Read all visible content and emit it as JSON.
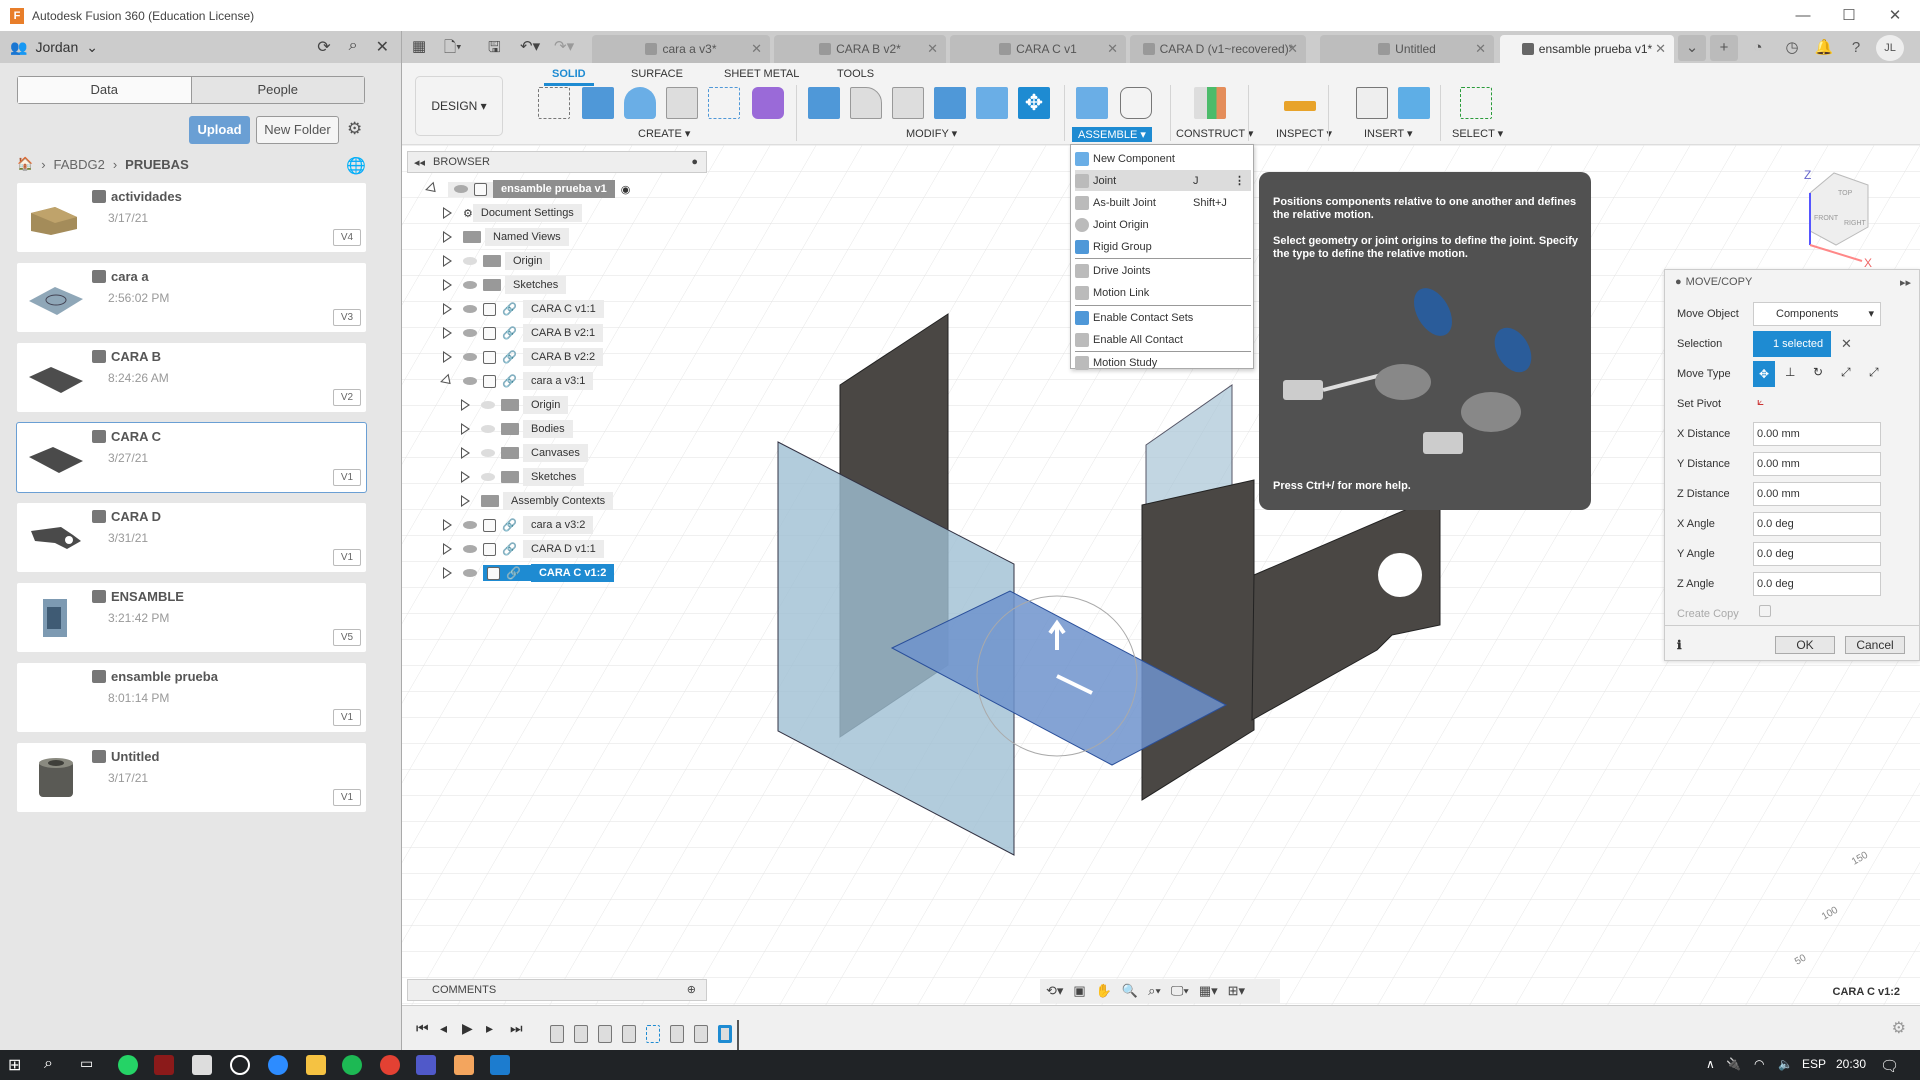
{
  "app": {
    "title": "Autodesk Fusion 360 (Education License)"
  },
  "window_controls": {
    "minimize": "—",
    "maximize": "☐",
    "close": "✕"
  },
  "left_header": {
    "user": "Jordan",
    "icons": [
      "refresh-icon",
      "search-icon",
      "close-icon"
    ]
  },
  "doc_tabs": [
    {
      "label": "cara a v3*",
      "active": false
    },
    {
      "label": "CARA B v2*",
      "active": false
    },
    {
      "label": "CARA C v1",
      "active": false
    },
    {
      "label": "CARA D (v1~recovered)*",
      "active": false
    },
    {
      "label": "Untitled",
      "active": false
    },
    {
      "label": "ensamble prueba v1*",
      "active": true
    }
  ],
  "top_right": {
    "avatar": "JL"
  },
  "data_panel": {
    "tabs": [
      "Data",
      "People"
    ],
    "upload": "Upload",
    "new_folder": "New Folder",
    "breadcrumb": [
      "FABDG2",
      "PRUEBAS"
    ],
    "files": [
      {
        "name": "actividades",
        "date": "3/17/21",
        "version": "V4"
      },
      {
        "name": "cara a",
        "date": "2:56:02 PM",
        "version": "V3"
      },
      {
        "name": "CARA B",
        "date": "8:24:26 AM",
        "version": "V2"
      },
      {
        "name": "CARA C",
        "date": "3/27/21",
        "version": "V1",
        "selected": true
      },
      {
        "name": "CARA D",
        "date": "3/31/21",
        "version": "V1"
      },
      {
        "name": "ENSAMBLE",
        "date": "3:21:42 PM",
        "version": "V5"
      },
      {
        "name": "ensamble prueba",
        "date": "8:01:14 PM",
        "version": "V1"
      },
      {
        "name": "Untitled",
        "date": "3/17/21",
        "version": "V1"
      }
    ]
  },
  "toolbar": {
    "workspace": "DESIGN ▾",
    "tabs": [
      "SOLID",
      "SURFACE",
      "SHEET METAL",
      "TOOLS"
    ],
    "groups": [
      "CREATE ▾",
      "MODIFY ▾",
      "ASSEMBLE ▾",
      "CONSTRUCT ▾",
      "INSPECT ▾",
      "INSERT ▾",
      "SELECT ▾"
    ],
    "accent": "#1e8bd2"
  },
  "assemble_menu": {
    "items": [
      {
        "label": "New Component",
        "shortcut": ""
      },
      {
        "label": "Joint",
        "shortcut": "J",
        "hover": true
      },
      {
        "label": "As-built Joint",
        "shortcut": "Shift+J"
      },
      {
        "label": "Joint Origin",
        "shortcut": ""
      },
      {
        "label": "Rigid Group",
        "shortcut": ""
      },
      {
        "label": "Drive Joints",
        "shortcut": ""
      },
      {
        "label": "Motion Link",
        "shortcut": ""
      },
      {
        "label": "Enable Contact Sets",
        "shortcut": ""
      },
      {
        "label": "Enable All Contact",
        "shortcut": ""
      },
      {
        "label": "Motion Study",
        "shortcut": ""
      }
    ]
  },
  "tooltip": {
    "p1": "Positions components relative to one another and defines the relative motion.",
    "p2": "Select geometry or joint origins to define the joint. Specify the type to define the relative motion.",
    "p3": "Press Ctrl+/ for more help."
  },
  "browser": {
    "title": "BROWSER",
    "root": "ensamble prueba v1",
    "items": [
      {
        "label": "Document Settings"
      },
      {
        "label": "Named Views"
      },
      {
        "label": "Origin"
      },
      {
        "label": "Sketches"
      },
      {
        "label": "CARA C v1:1"
      },
      {
        "label": "CARA B v2:1"
      },
      {
        "label": "CARA B v2:2"
      },
      {
        "label": "cara a v3:1"
      },
      {
        "label": "Origin"
      },
      {
        "label": "Bodies"
      },
      {
        "label": "Canvases"
      },
      {
        "label": "Sketches"
      },
      {
        "label": "Assembly Contexts"
      },
      {
        "label": "cara a v3:2"
      },
      {
        "label": "CARA D v1:1"
      },
      {
        "label": "CARA C v1:2"
      }
    ]
  },
  "move_copy": {
    "title": "MOVE/COPY",
    "move_object_label": "Move Object",
    "move_object_value": "Components",
    "selection_label": "Selection",
    "selection_value": "1 selected",
    "move_type_label": "Move Type",
    "set_pivot_label": "Set Pivot",
    "fields": [
      {
        "label": "X Distance",
        "value": "0.00 mm"
      },
      {
        "label": "Y Distance",
        "value": "0.00 mm"
      },
      {
        "label": "Z Distance",
        "value": "0.00 mm"
      },
      {
        "label": "X Angle",
        "value": "0.0 deg"
      },
      {
        "label": "Y Angle",
        "value": "0.0 deg"
      },
      {
        "label": "Z Angle",
        "value": "0.0 deg"
      }
    ],
    "create_copy_label": "Create Copy",
    "ok": "OK",
    "cancel": "Cancel"
  },
  "viewcube": {
    "top": "TOP",
    "front": "FRONT",
    "right": "RIGHT",
    "z": "Z",
    "x": "X"
  },
  "grid_labels": [
    "150",
    "100",
    "50"
  ],
  "comments": {
    "title": "COMMENTS"
  },
  "status": {
    "selection": "CARA C v1:2"
  },
  "taskbar": {
    "lang": "ESP",
    "time": "20:30"
  }
}
